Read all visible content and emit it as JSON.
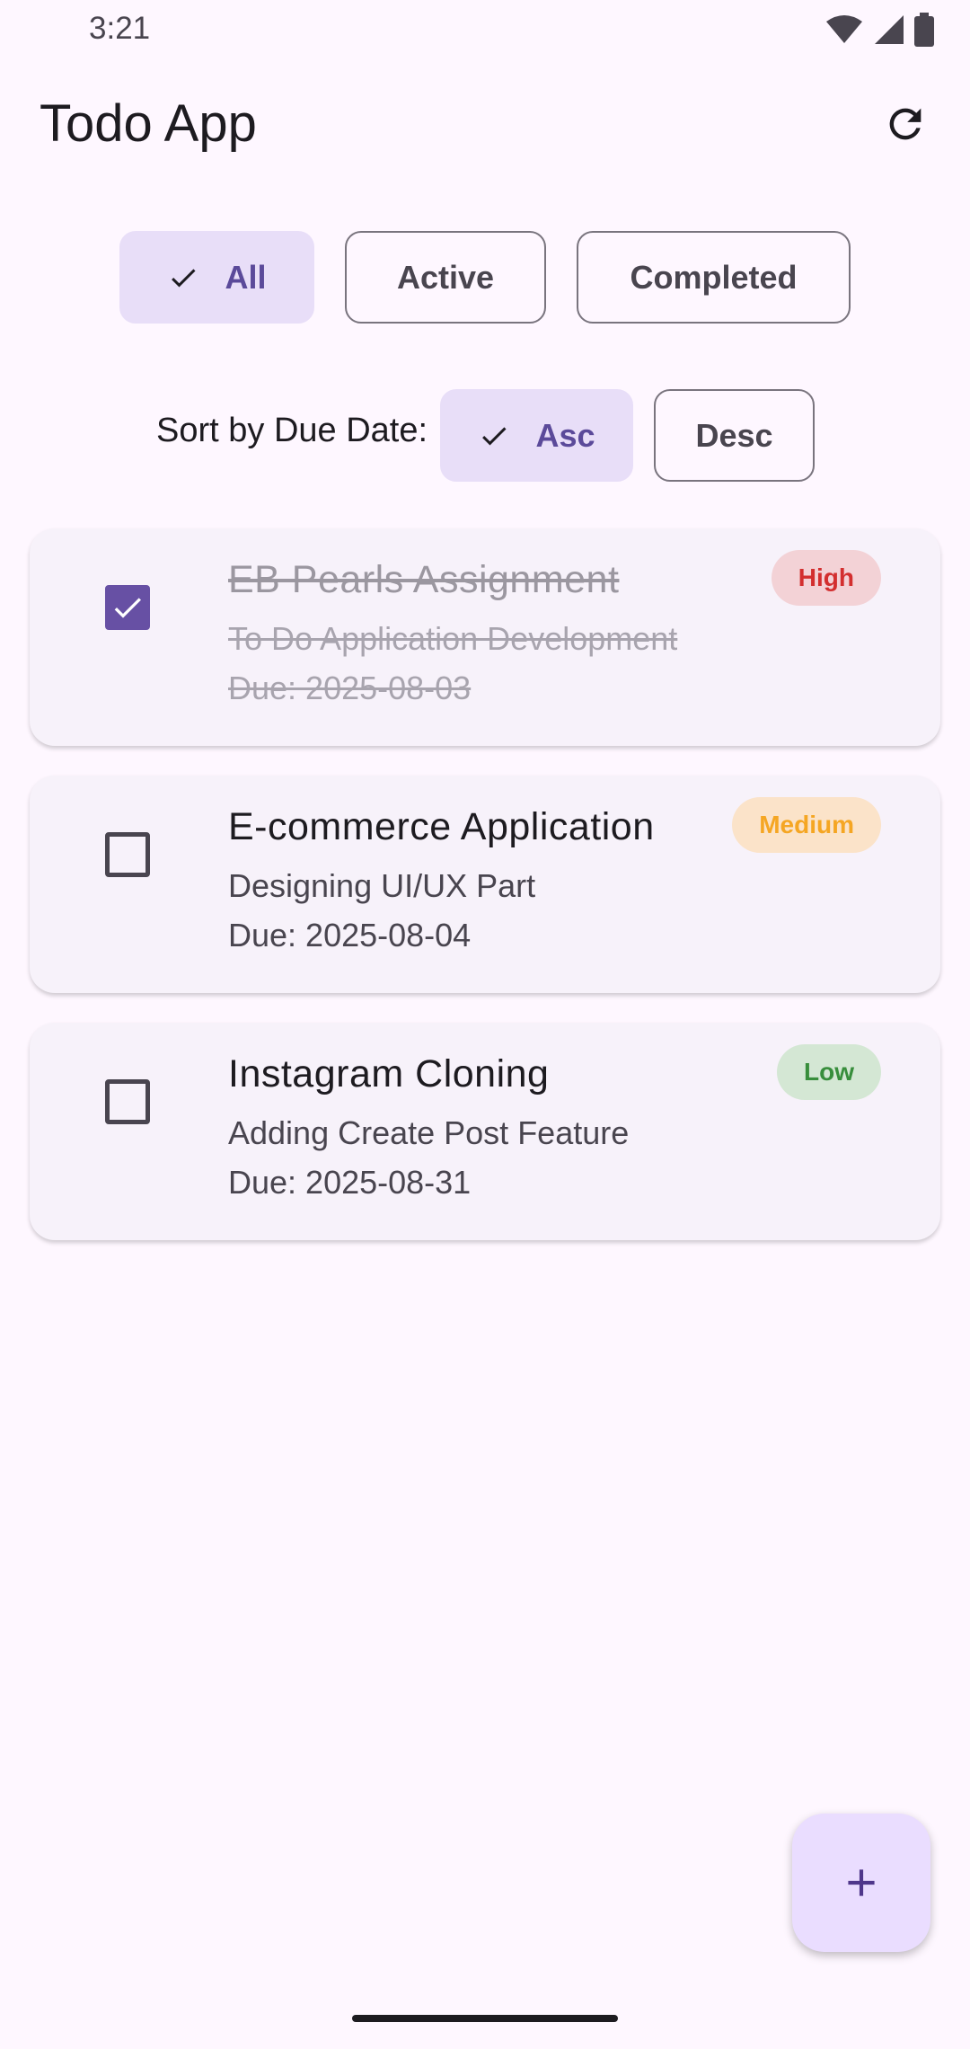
{
  "status_bar": {
    "time": "3:21"
  },
  "app_bar": {
    "title": "Todo App",
    "refresh_icon": "refresh-icon"
  },
  "filters": [
    {
      "label": "All",
      "selected": true
    },
    {
      "label": "Active",
      "selected": false
    },
    {
      "label": "Completed",
      "selected": false
    }
  ],
  "sort": {
    "label": "Sort by Due Date:",
    "options": [
      {
        "label": "Asc",
        "selected": true
      },
      {
        "label": "Desc",
        "selected": false
      }
    ]
  },
  "todos": [
    {
      "title": "EB Pearls Assignment",
      "description": "To Do Application Development",
      "due": "Due: 2025-08-03",
      "priority": "High",
      "completed": true
    },
    {
      "title": "E-commerce Application",
      "description": "Designing UI/UX Part",
      "due": "Due: 2025-08-04",
      "priority": "Medium",
      "completed": false
    },
    {
      "title": "Instagram Cloning",
      "description": "Adding Create Post Feature",
      "due": "Due: 2025-08-31",
      "priority": "Low",
      "completed": false
    }
  ],
  "fab": {
    "icon": "add-icon"
  },
  "colors": {
    "background": "#fef7ff",
    "primary": "#6750a4",
    "chip_selected": "#e8def8",
    "high": "#d32f2f",
    "medium": "#f5a623",
    "low": "#388e3c"
  }
}
